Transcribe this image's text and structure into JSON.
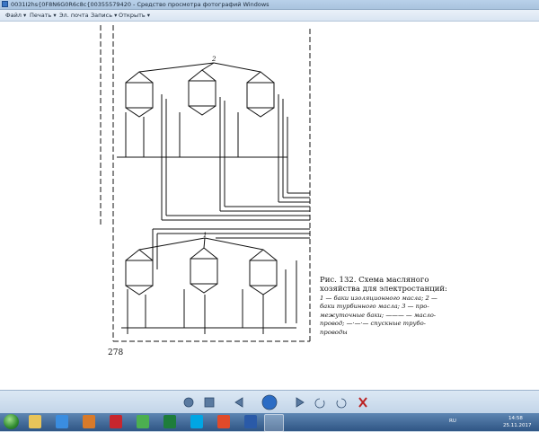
{
  "window": {
    "title": "0031I2hs{0F8N6G0R6c8c{00355579420 - Средство просмотра фотографий Windows"
  },
  "menu": {
    "file": "Файл ▾",
    "print": "Печать ▾",
    "email": "Эл. почта",
    "burn": "Запись ▾",
    "open": "Открыть ▾"
  },
  "figure": {
    "labels": {
      "top_group": "2",
      "bottom_group": "1"
    },
    "caption_title": "Рис. 132. Схема масляного хозяйства для электростанций:",
    "caption_line1": "1 — баки изоляционного масла; 2 —",
    "caption_line2": "баки турбинного масла; 3 — про-",
    "caption_line3": "межуточные баки; ——— — масло-",
    "caption_line4": "провод; —·—·— спускные трубо-",
    "caption_line5": "проводы",
    "page_number": "278"
  },
  "taskbar": {
    "language": "RU",
    "time": "14:58",
    "date": "25.11.2017"
  },
  "colors": {
    "taskbar": "#2f5584",
    "viewer_bg": "#ffffff",
    "accent": "#3a76c4"
  }
}
